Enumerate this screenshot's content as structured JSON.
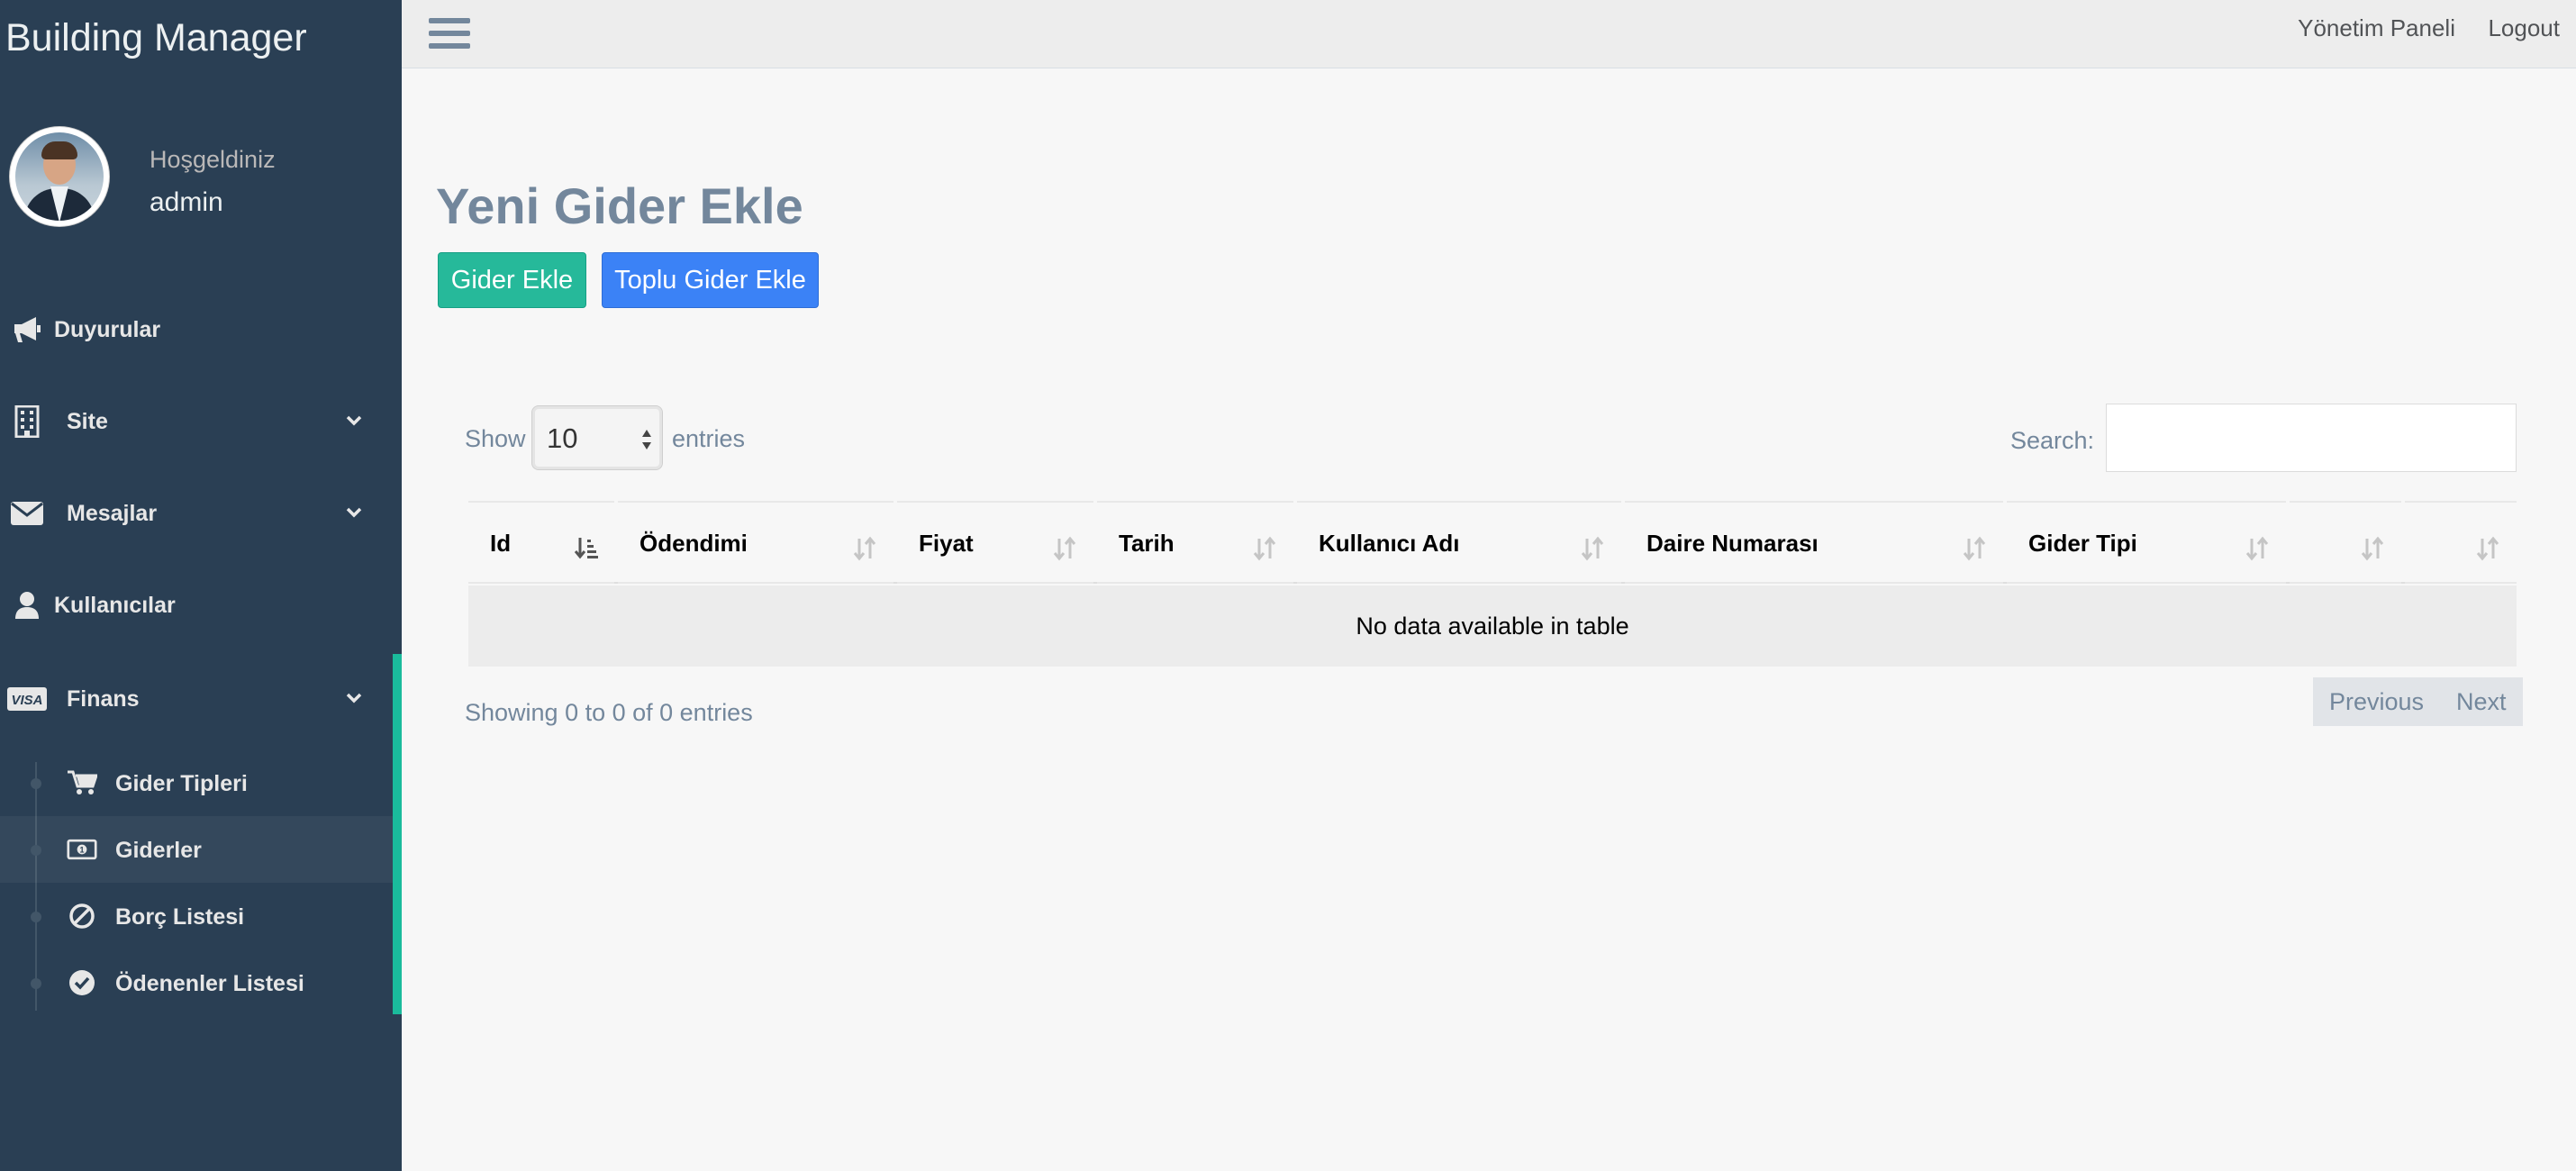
{
  "sidebar": {
    "brand": "Building Manager",
    "profile": {
      "welcome": "Hoşgeldiniz",
      "username": "admin"
    },
    "items": [
      {
        "label": "Duyurular",
        "icon": "bullhorn-icon"
      },
      {
        "label": "Site",
        "icon": "building-icon"
      },
      {
        "label": "Mesajlar",
        "icon": "envelope-icon"
      },
      {
        "label": "Kullanıcılar",
        "icon": "user-icon"
      },
      {
        "label": "Finans",
        "icon": "visa-card-icon"
      }
    ],
    "finans_sub": [
      {
        "label": "Gider Tipleri",
        "icon": "shopping-cart-icon"
      },
      {
        "label": "Giderler",
        "icon": "money-bill-icon"
      },
      {
        "label": "Borç Listesi",
        "icon": "ban-icon"
      },
      {
        "label": "Ödenenler Listesi",
        "icon": "check-circle-icon"
      }
    ]
  },
  "topnav": {
    "links": [
      "Yönetim Paneli",
      "Logout"
    ]
  },
  "main": {
    "title": "Yeni Gider Ekle",
    "buttons": {
      "add": "Gider Ekle",
      "bulk_add": "Toplu Gider Ekle"
    },
    "table_controls": {
      "show": "Show",
      "entries_value": "10",
      "entries": "entries",
      "search_label": "Search:",
      "search_value": ""
    },
    "table": {
      "columns": [
        "Id",
        "Ödendimi",
        "Fiyat",
        "Tarih",
        "Kullanıcı Adı",
        "Daire Numarası",
        "Gider Tipi",
        "",
        ""
      ],
      "empty_message": "No data available in table",
      "info": "Showing 0 to 0 of 0 entries"
    },
    "pagination": {
      "previous": "Previous",
      "next": "Next"
    }
  },
  "colors": {
    "sidebar_bg": "#2a3f54",
    "accent_green": "#26b99a",
    "active_border": "#1abb9c",
    "primary_blue": "#3b82f6",
    "text_muted": "#73879c"
  }
}
